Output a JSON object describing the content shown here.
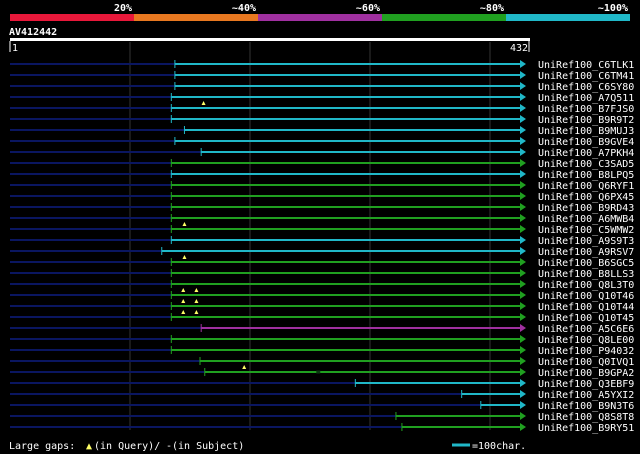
{
  "header": {
    "identity_ticks": [
      "20%",
      "~40%",
      "~60%",
      "~80%",
      "~100%"
    ],
    "identity_colors": [
      "#e8183a",
      "#e87820",
      "#a030a0",
      "#20a020",
      "#20b8c8"
    ],
    "query_accession": "AV412442",
    "ruler_start": "1",
    "ruler_end": "432",
    "query_length": 432
  },
  "hits": [
    {
      "name": "UniRef100_C6TLK1",
      "start": 139,
      "end": 432,
      "color": "#20b8c8",
      "gaps_query": [],
      "gaps_subject": []
    },
    {
      "name": "UniRef100_C6TM41",
      "start": 139,
      "end": 432,
      "color": "#20b8c8",
      "gaps_query": [],
      "gaps_subject": []
    },
    {
      "name": "UniRef100_C6SY80",
      "start": 139,
      "end": 432,
      "color": "#20b8c8",
      "gaps_query": [],
      "gaps_subject": []
    },
    {
      "name": "UniRef100_A7Q511",
      "start": 136,
      "end": 432,
      "color": "#20b8c8",
      "gaps_query": [],
      "gaps_subject": []
    },
    {
      "name": "UniRef100_B7FJS0",
      "start": 136,
      "end": 432,
      "color": "#20b8c8",
      "gaps_query": [
        163
      ],
      "gaps_subject": []
    },
    {
      "name": "UniRef100_B9R9T2",
      "start": 136,
      "end": 432,
      "color": "#20b8c8",
      "gaps_query": [],
      "gaps_subject": []
    },
    {
      "name": "UniRef100_B9MUJ3",
      "start": 147,
      "end": 432,
      "color": "#20b8c8",
      "gaps_query": [],
      "gaps_subject": []
    },
    {
      "name": "UniRef100_B9GVE4",
      "start": 139,
      "end": 432,
      "color": "#20b8c8",
      "gaps_query": [],
      "gaps_subject": []
    },
    {
      "name": "UniRef100_A7PKH4",
      "start": 161,
      "end": 432,
      "color": "#20b8c8",
      "gaps_query": [],
      "gaps_subject": []
    },
    {
      "name": "UniRef100_C3SAD5",
      "start": 136,
      "end": 432,
      "color": "#20a020",
      "gaps_query": [],
      "gaps_subject": []
    },
    {
      "name": "UniRef100_B8LPQ5",
      "start": 136,
      "end": 432,
      "color": "#20b8c8",
      "gaps_query": [],
      "gaps_subject": []
    },
    {
      "name": "UniRef100_Q6RYF1",
      "start": 136,
      "end": 432,
      "color": "#20a020",
      "gaps_query": [],
      "gaps_subject": []
    },
    {
      "name": "UniRef100_Q6PX45",
      "start": 136,
      "end": 432,
      "color": "#20a020",
      "gaps_query": [],
      "gaps_subject": []
    },
    {
      "name": "UniRef100_B9RD43",
      "start": 136,
      "end": 432,
      "color": "#20a020",
      "gaps_query": [],
      "gaps_subject": []
    },
    {
      "name": "UniRef100_A6MWB4",
      "start": 136,
      "end": 432,
      "color": "#20a020",
      "gaps_query": [],
      "gaps_subject": []
    },
    {
      "name": "UniRef100_C5WMW2",
      "start": 136,
      "end": 432,
      "color": "#20a020",
      "gaps_query": [
        147
      ],
      "gaps_subject": []
    },
    {
      "name": "UniRef100_A9S9T3",
      "start": 136,
      "end": 432,
      "color": "#20b8c8",
      "gaps_query": [],
      "gaps_subject": []
    },
    {
      "name": "UniRef100_A9RSV7",
      "start": 128,
      "end": 432,
      "color": "#20b8c8",
      "gaps_query": [],
      "gaps_subject": []
    },
    {
      "name": "UniRef100_B6SGC5",
      "start": 136,
      "end": 432,
      "color": "#20a020",
      "gaps_query": [
        147
      ],
      "gaps_subject": []
    },
    {
      "name": "UniRef100_B8LLS3",
      "start": 136,
      "end": 432,
      "color": "#20a020",
      "gaps_query": [],
      "gaps_subject": []
    },
    {
      "name": "UniRef100_Q8L3T0",
      "start": 136,
      "end": 432,
      "color": "#20a020",
      "gaps_query": [],
      "gaps_subject": []
    },
    {
      "name": "UniRef100_Q10T46",
      "start": 136,
      "end": 432,
      "color": "#20a020",
      "gaps_query": [
        146,
        157
      ],
      "gaps_subject": []
    },
    {
      "name": "UniRef100_Q10T44",
      "start": 136,
      "end": 432,
      "color": "#20a020",
      "gaps_query": [
        146,
        157
      ],
      "gaps_subject": []
    },
    {
      "name": "UniRef100_Q10T45",
      "start": 136,
      "end": 432,
      "color": "#20a020",
      "gaps_query": [
        146,
        157
      ],
      "gaps_subject": []
    },
    {
      "name": "UniRef100_A5C6E6",
      "start": 161,
      "end": 432,
      "color": "#a030a0",
      "gaps_query": [],
      "gaps_subject": []
    },
    {
      "name": "UniRef100_Q8LE00",
      "start": 136,
      "end": 432,
      "color": "#20a020",
      "gaps_query": [],
      "gaps_subject": []
    },
    {
      "name": "UniRef100_P94032",
      "start": 136,
      "end": 432,
      "color": "#20a020",
      "gaps_query": [],
      "gaps_subject": []
    },
    {
      "name": "UniRef100_Q0IVQ1",
      "start": 160,
      "end": 432,
      "color": "#20a020",
      "gaps_query": [],
      "gaps_subject": []
    },
    {
      "name": "UniRef100_B9GPA2",
      "start": 164,
      "end": 432,
      "color": "#20a020",
      "gaps_query": [
        197
      ],
      "gaps_subject": [
        259
      ]
    },
    {
      "name": "UniRef100_Q3EBF9",
      "start": 290,
      "end": 432,
      "color": "#20b8c8",
      "gaps_query": [],
      "gaps_subject": []
    },
    {
      "name": "UniRef100_A5YXI2",
      "start": 379,
      "end": 432,
      "color": "#20b8c8",
      "gaps_query": [],
      "gaps_subject": []
    },
    {
      "name": "UniRef100_B9N3T6",
      "start": 395,
      "end": 432,
      "color": "#20b8c8",
      "gaps_query": [],
      "gaps_subject": []
    },
    {
      "name": "UniRef100_Q8S8T8",
      "start": 324,
      "end": 432,
      "color": "#20a020",
      "gaps_query": [],
      "gaps_subject": []
    },
    {
      "name": "UniRef100_B9RY51",
      "start": 329,
      "end": 432,
      "color": "#20a020",
      "gaps_query": [],
      "gaps_subject": []
    }
  ],
  "footer": {
    "legend_text": "Large gaps:",
    "legend_query": "(in Query)/",
    "legend_dash": "-",
    "legend_subject": " (in Subject)",
    "scale_label": "=100char."
  }
}
